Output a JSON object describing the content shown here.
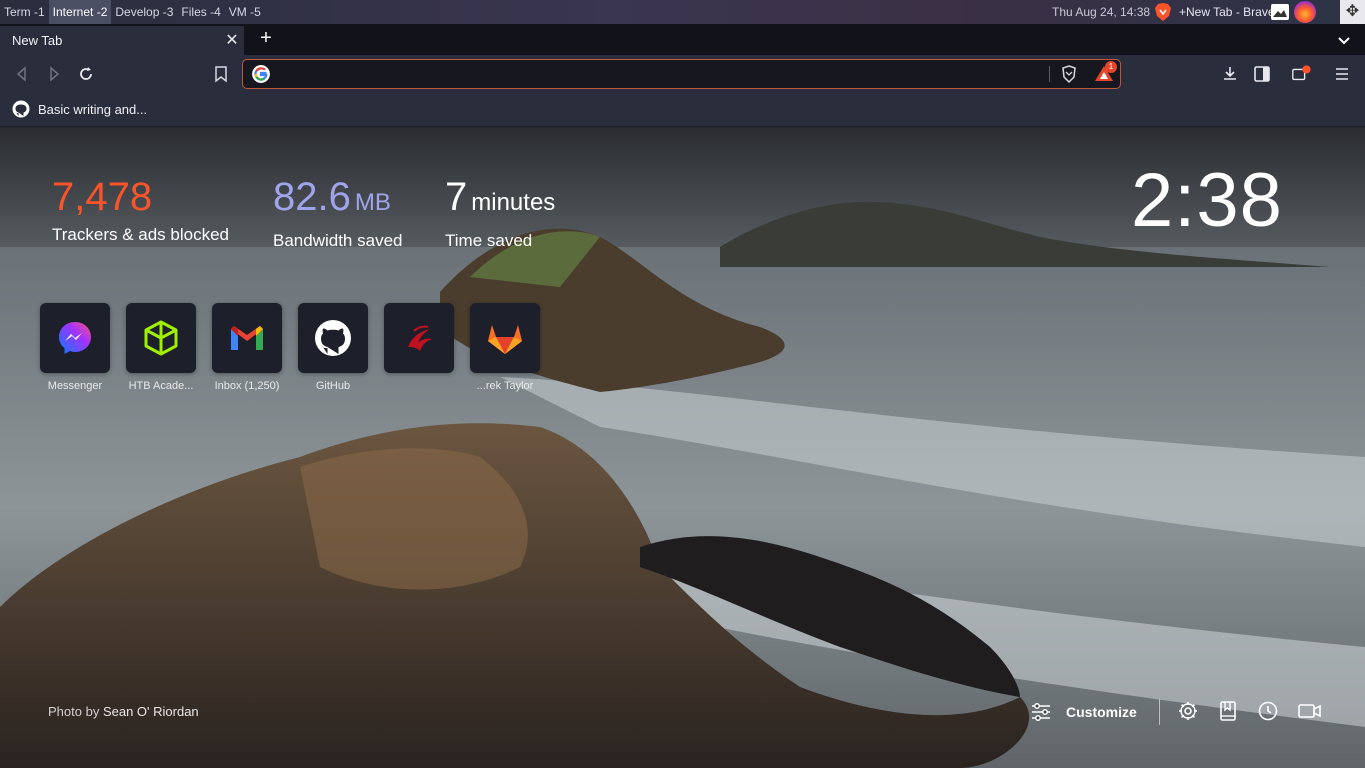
{
  "os_panel": {
    "workspaces": [
      "Term -1",
      "Internet -2",
      "Develop -3",
      "Files -4",
      "VM -5"
    ],
    "active_workspace": "Internet -2",
    "clock": "Thu Aug 24, 14:38",
    "window_title": "+New Tab - Brave"
  },
  "tabs": [
    {
      "title": "New Tab",
      "active": true
    }
  ],
  "toolbar": {
    "address_value": "",
    "rewards_badge": "1"
  },
  "bookmarks": [
    {
      "label": "Basic writing and...",
      "icon": "github-icon"
    }
  ],
  "stats": {
    "trackers": {
      "value": "7,478",
      "label": "Trackers & ads blocked"
    },
    "bandwidth": {
      "value": "82.6",
      "unit": "MB",
      "label": "Bandwidth saved"
    },
    "time": {
      "value": "7",
      "unit": "minutes",
      "label": "Time saved"
    }
  },
  "clock": "2:38",
  "top_sites": [
    {
      "label": "Messenger",
      "icon": "messenger-icon"
    },
    {
      "label": "HTB Acade...",
      "icon": "htb-icon"
    },
    {
      "label": "Inbox (1,250)",
      "icon": "gmail-icon"
    },
    {
      "label": "GitHub",
      "icon": "github-icon"
    },
    {
      "label": "",
      "icon": "dragon-icon"
    },
    {
      "label": "...rek Taylor",
      "icon": "gitlab-icon"
    }
  ],
  "footer": {
    "photo_prefix": "Photo by",
    "photo_author": "Sean O' Riordan",
    "customize_label": "Customize"
  },
  "colors": {
    "trackers": "#fb542b",
    "bandwidth": "#a0a5eb",
    "url_border": "#c0583b"
  }
}
